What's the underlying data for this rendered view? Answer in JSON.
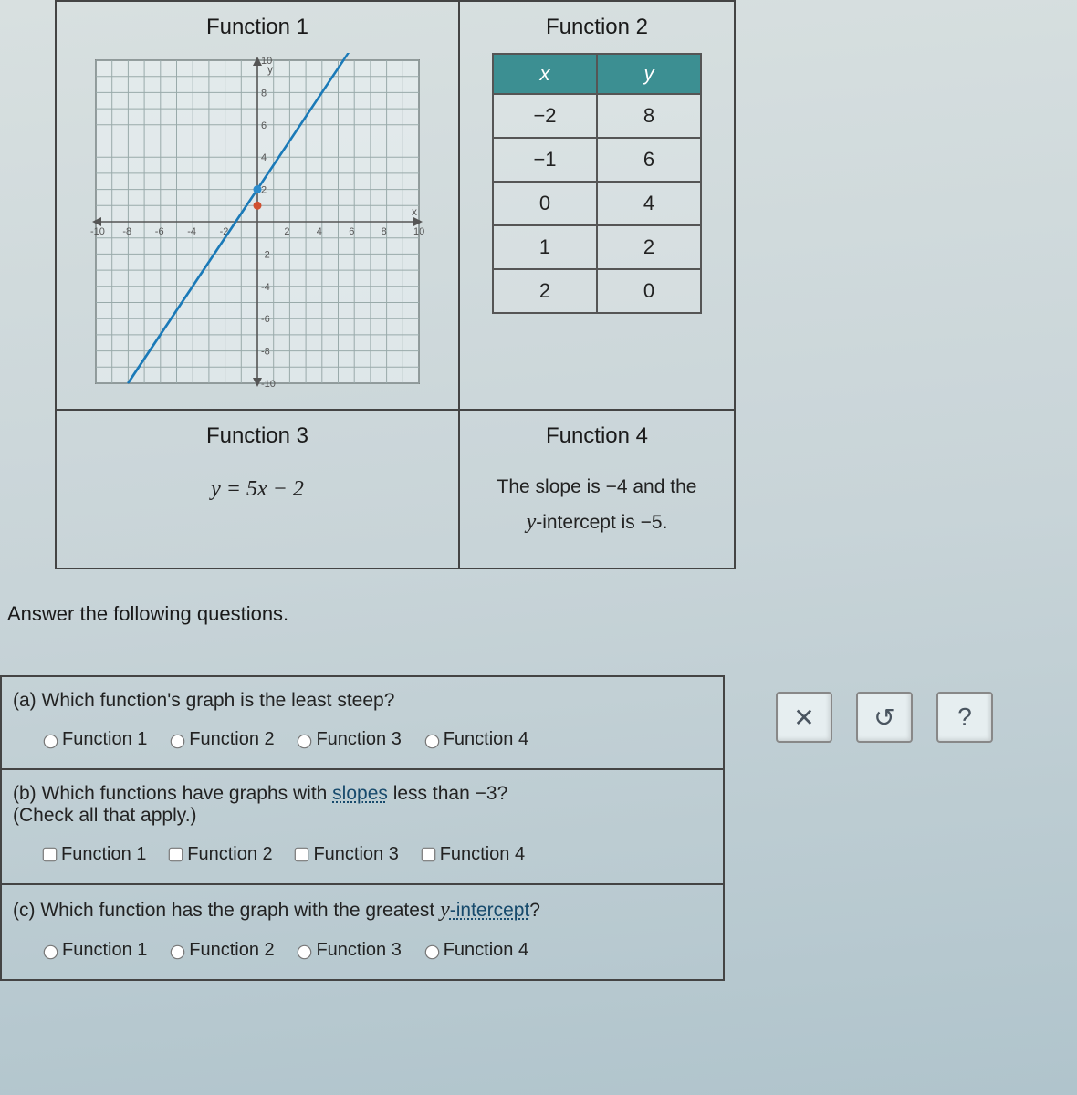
{
  "functions": {
    "f1": {
      "title": "Function 1"
    },
    "f2": {
      "title": "Function 2",
      "headers": {
        "x": "x",
        "y": "y"
      },
      "rows": [
        {
          "x": "−2",
          "y": "8"
        },
        {
          "x": "−1",
          "y": "6"
        },
        {
          "x": "0",
          "y": "4"
        },
        {
          "x": "1",
          "y": "2"
        },
        {
          "x": "2",
          "y": "0"
        }
      ]
    },
    "f3": {
      "title": "Function 3",
      "equation": "y = 5x − 2"
    },
    "f4": {
      "title": "Function 4",
      "line1a": "The slope is ",
      "line1b": "−4",
      "line1c": " and the",
      "line2a": "y",
      "line2b": "-intercept is ",
      "line2c": "−5",
      "line2d": "."
    }
  },
  "answer_header": "Answer the following questions.",
  "questions": {
    "a": {
      "prompt": "(a) Which function's graph is the least steep?",
      "options": [
        "Function 1",
        "Function 2",
        "Function 3",
        "Function 4"
      ]
    },
    "b": {
      "prompt_a": "(b) Which functions have graphs with ",
      "prompt_link": "slopes",
      "prompt_b": " less than ",
      "prompt_num": "−3",
      "prompt_c": "?",
      "sub": "(Check all that apply.)",
      "options": [
        "Function 1",
        "Function 2",
        "Function 3",
        "Function 4"
      ]
    },
    "c": {
      "prompt_a": "(c) Which function has the graph with the greatest ",
      "prompt_var": "y",
      "prompt_link": "-intercept",
      "prompt_b": "?",
      "options": [
        "Function 1",
        "Function 2",
        "Function 3",
        "Function 4"
      ]
    }
  },
  "toolbar": {
    "close": "✕",
    "reset": "↺",
    "help": "?"
  },
  "chart_data": {
    "type": "line",
    "title": "Function 1",
    "xlabel": "x",
    "ylabel": "y",
    "xlim": [
      -10,
      10
    ],
    "ylim": [
      -10,
      10
    ],
    "x": [
      -8,
      0
    ],
    "y": [
      -10,
      2
    ],
    "xticks": [
      -10,
      -8,
      -6,
      -4,
      -2,
      2,
      4,
      6,
      8,
      10
    ],
    "yticks": [
      -10,
      -8,
      -6,
      -4,
      -2,
      2,
      4,
      6,
      8,
      10
    ],
    "points": [
      {
        "x": 0,
        "y": 2
      },
      {
        "x": 0,
        "y": 1
      }
    ]
  }
}
